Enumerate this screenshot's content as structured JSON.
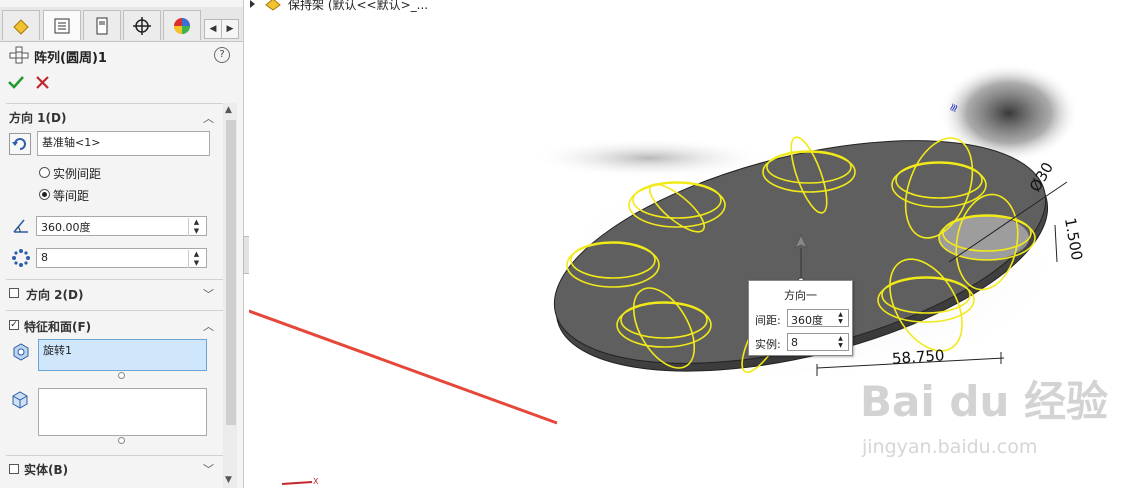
{
  "feature_title": "阵列(圆周)1",
  "help_label": "?",
  "direction1": {
    "label": "方向 1(D)",
    "axis_value": "基准轴<1>",
    "option_instance_spacing": "实例间距",
    "option_equal_spacing": "等间距",
    "angle_value": "360.00度",
    "count_value": "8"
  },
  "direction2": {
    "label": "方向 2(D)"
  },
  "features_faces": {
    "label": "特征和面(F)",
    "item": "旋转1"
  },
  "bodies": {
    "label": "实体(B)"
  },
  "tree_label": "保持架 (默认<<默认>_...",
  "popup": {
    "title": "方向一",
    "spacing_label": "间距:",
    "spacing_value": "360度",
    "count_label": "实例:",
    "count_value": "8"
  },
  "dimensions": {
    "diameter": "Ø30",
    "thickness": "1.500",
    "width": "58.750"
  },
  "watermark": {
    "brand": "Bai du 经验",
    "url": "jingyan.baidu.com"
  },
  "colors": {
    "accent_green": "#1f9a2e",
    "cancel_red": "#c1272d",
    "ring_yellow": "#f2ea18",
    "arrow_red": "#e5473a"
  }
}
